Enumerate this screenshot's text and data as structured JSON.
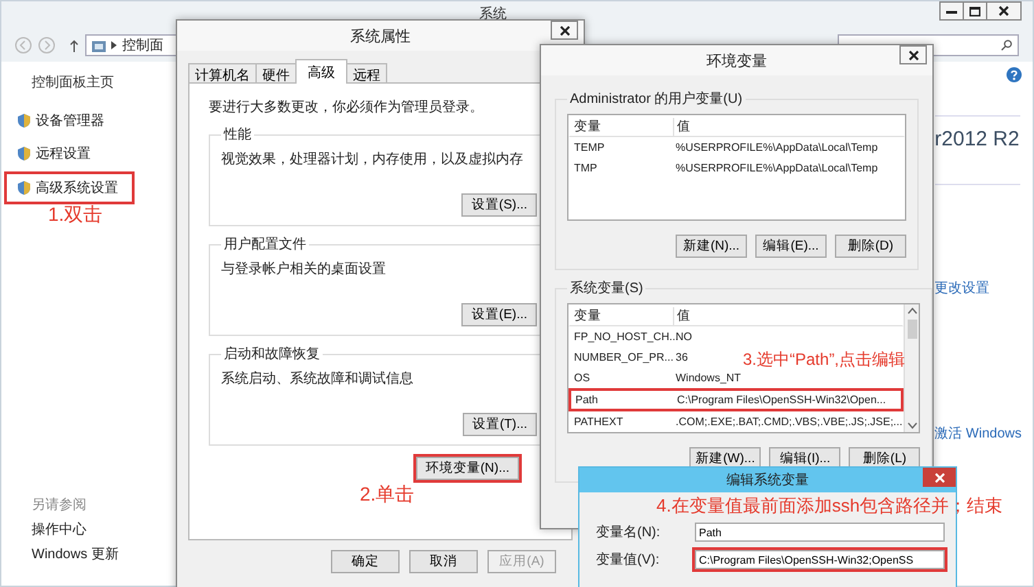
{
  "control_panel": {
    "title": "系统",
    "address": "控制面",
    "home_link": "控制面板主页",
    "tasks": [
      {
        "label": "设备管理器",
        "highlighted": false
      },
      {
        "label": "远程设置",
        "highlighted": false
      },
      {
        "label": "高级系统设置",
        "highlighted": true
      }
    ],
    "see_also_heading": "另请参阅",
    "see_also": [
      "操作中心",
      "Windows 更新"
    ],
    "edition_text": "r2012 R2",
    "change_settings_link": "更改设置",
    "activate_link": "激活 Windows"
  },
  "system_properties": {
    "title": "系统属性",
    "tabs": [
      {
        "label": "计算机名",
        "selected": false
      },
      {
        "label": "硬件",
        "selected": false
      },
      {
        "label": "高级",
        "selected": true
      },
      {
        "label": "远程",
        "selected": false
      }
    ],
    "notice": "要进行大多数更改，你必须作为管理员登录。",
    "groups": [
      {
        "title": "性能",
        "description": "视觉效果，处理器计划，内存使用，以及虚拟内存",
        "button": "设置(S)..."
      },
      {
        "title": "用户配置文件",
        "description": "与登录帐户相关的桌面设置",
        "button": "设置(E)..."
      },
      {
        "title": "启动和故障恢复",
        "description": "系统启动、系统故障和调试信息",
        "button": "设置(T)..."
      }
    ],
    "env_button": {
      "label": "环境变量(N)...",
      "highlighted": true
    },
    "buttons": [
      {
        "label": "确定",
        "disabled": false
      },
      {
        "label": "取消",
        "disabled": false
      },
      {
        "label": "应用(A)",
        "disabled": true
      }
    ]
  },
  "environment_variables": {
    "title": "环境变量",
    "user_section": {
      "title": "Administrator 的用户变量(U)",
      "columns": [
        "变量",
        "值"
      ],
      "rows": [
        {
          "name": "TEMP",
          "value": "%USERPROFILE%\\AppData\\Local\\Temp",
          "highlighted": false
        },
        {
          "name": "TMP",
          "value": "%USERPROFILE%\\AppData\\Local\\Temp",
          "highlighted": false
        }
      ],
      "buttons": [
        "新建(N)...",
        "编辑(E)...",
        "删除(D)"
      ]
    },
    "system_section": {
      "title": "系统变量(S)",
      "columns": [
        "变量",
        "值"
      ],
      "rows": [
        {
          "name": "FP_NO_HOST_CH...",
          "value": "NO",
          "highlighted": false
        },
        {
          "name": "NUMBER_OF_PR...",
          "value": "36",
          "highlighted": false
        },
        {
          "name": "OS",
          "value": "Windows_NT",
          "highlighted": false
        },
        {
          "name": "Path",
          "value": "C:\\Program Files\\OpenSSH-Win32\\Open...",
          "highlighted": true
        },
        {
          "name": "PATHEXT",
          "value": ".COM;.EXE;.BAT;.CMD;.VBS;.VBE;.JS;.JSE;...",
          "highlighted": false
        }
      ],
      "buttons": [
        "新建(W)...",
        "编辑(I)...",
        "删除(L)"
      ]
    }
  },
  "edit_dialog": {
    "title": "编辑系统变量",
    "name_label": "变量名(N):",
    "name_value": "Path",
    "value_label": "变量值(V):",
    "value_value": "C:\\Program Files\\OpenSSH-Win32;OpenSS",
    "value_highlighted": true
  },
  "annotations": [
    {
      "kind": "step1",
      "text": "1.双击"
    },
    {
      "kind": "step2",
      "text": "2.单击"
    },
    {
      "kind": "step3",
      "text": "3.选中“Path”,点击编辑"
    },
    {
      "kind": "step4",
      "text": "4.在变量值最前面添加ssh包含路径并；结束"
    }
  ]
}
